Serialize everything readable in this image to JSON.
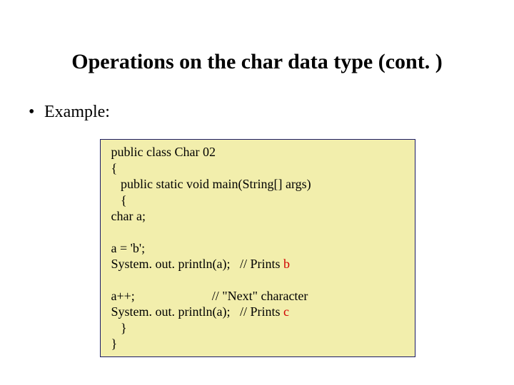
{
  "title": "Operations on the char data type (cont. )",
  "bullet_label": "Example:",
  "code": {
    "l1": " public class Char 02",
    "l2": " {",
    "l3": "    public static void main(String[] args)",
    "l4": "    {",
    "l5": " char a;",
    "l6": " a = 'b';",
    "l7_a": " System. out. println(a);   // Prints ",
    "l7_b": "b",
    "l8": " a++;                        // \"Next\" character",
    "l9_a": " System. out. println(a);   // Prints ",
    "l9_b": "c",
    "l10": "    }",
    "l11": " }"
  }
}
